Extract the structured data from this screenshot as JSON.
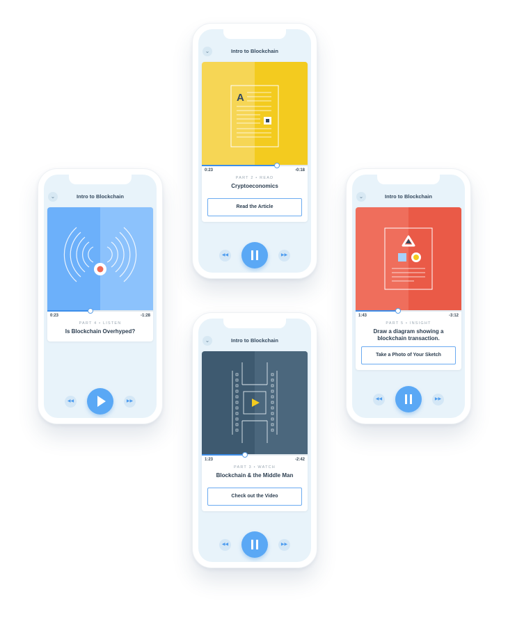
{
  "colors": {
    "accent": "#5aa8f5",
    "listen": "#6cb0fa",
    "read": "#f5d048",
    "watch": "#3e5a70",
    "insight": "#ee6a55"
  },
  "phones": [
    {
      "id": "listen",
      "title": "Intro to Blockchain",
      "back_icon": "chevron-down-icon",
      "elapsed": "0:23",
      "remaining": "-1:28",
      "progress": 0.41,
      "part": "PART 4 • LISTEN",
      "name": "Is Blockchain Overhyped?",
      "cta": "",
      "player_state": "paused",
      "rewind_icon": "rewind-icon",
      "forward_icon": "fast-forward-icon",
      "art_icon": "audio-waves-icon"
    },
    {
      "id": "read",
      "title": "Intro to Blockchain",
      "back_icon": "chevron-down-icon",
      "elapsed": "0:23",
      "remaining": "-0:18",
      "progress": 0.71,
      "part": "PART 2 • READ",
      "name": "Cryptoeconomics",
      "cta": "Read the Article",
      "player_state": "playing",
      "rewind_icon": "rewind-icon",
      "forward_icon": "fast-forward-icon",
      "art_icon": "article-document-icon"
    },
    {
      "id": "watch",
      "title": "Intro to Blockchain",
      "back_icon": "chevron-down-icon",
      "elapsed": "1:23",
      "remaining": "-2:42",
      "progress": 0.41,
      "part": "PART 3 • WATCH",
      "name": "Blockchain & the Middle Man",
      "cta": "Check out the Video",
      "player_state": "playing",
      "rewind_icon": "rewind-icon",
      "forward_icon": "fast-forward-icon",
      "art_icon": "film-strip-icon"
    },
    {
      "id": "insight",
      "title": "Intro to Blockchain",
      "back_icon": "chevron-down-icon",
      "elapsed": "1:43",
      "remaining": "-3:12",
      "progress": 0.4,
      "part": "PART 5 • INSIGHT",
      "name": "Draw a diagram showing a blockchain transaction.",
      "cta": "Take a Photo of Your Sketch",
      "player_state": "playing",
      "rewind_icon": "rewind-icon",
      "forward_icon": "fast-forward-icon",
      "art_icon": "shapes-sketch-icon"
    }
  ]
}
